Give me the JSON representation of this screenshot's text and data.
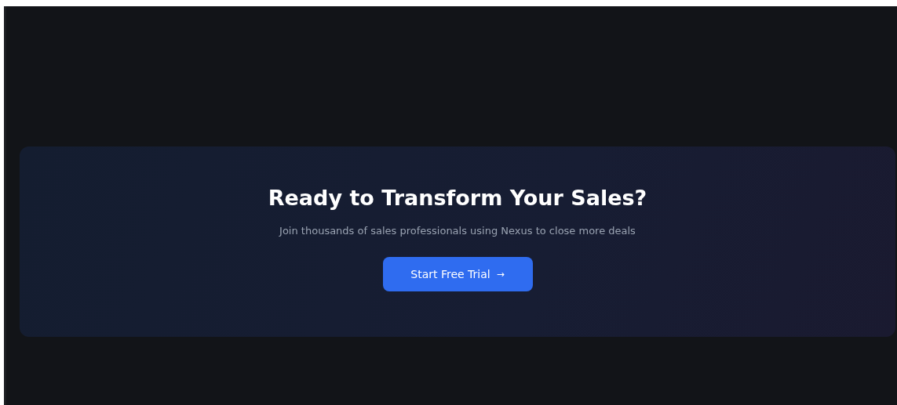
{
  "cta": {
    "title": "Ready to Transform Your Sales?",
    "subtitle": "Join thousands of sales professionals using Nexus to close more deals",
    "button": {
      "label": "Start Free Trial",
      "arrow": "→"
    }
  }
}
